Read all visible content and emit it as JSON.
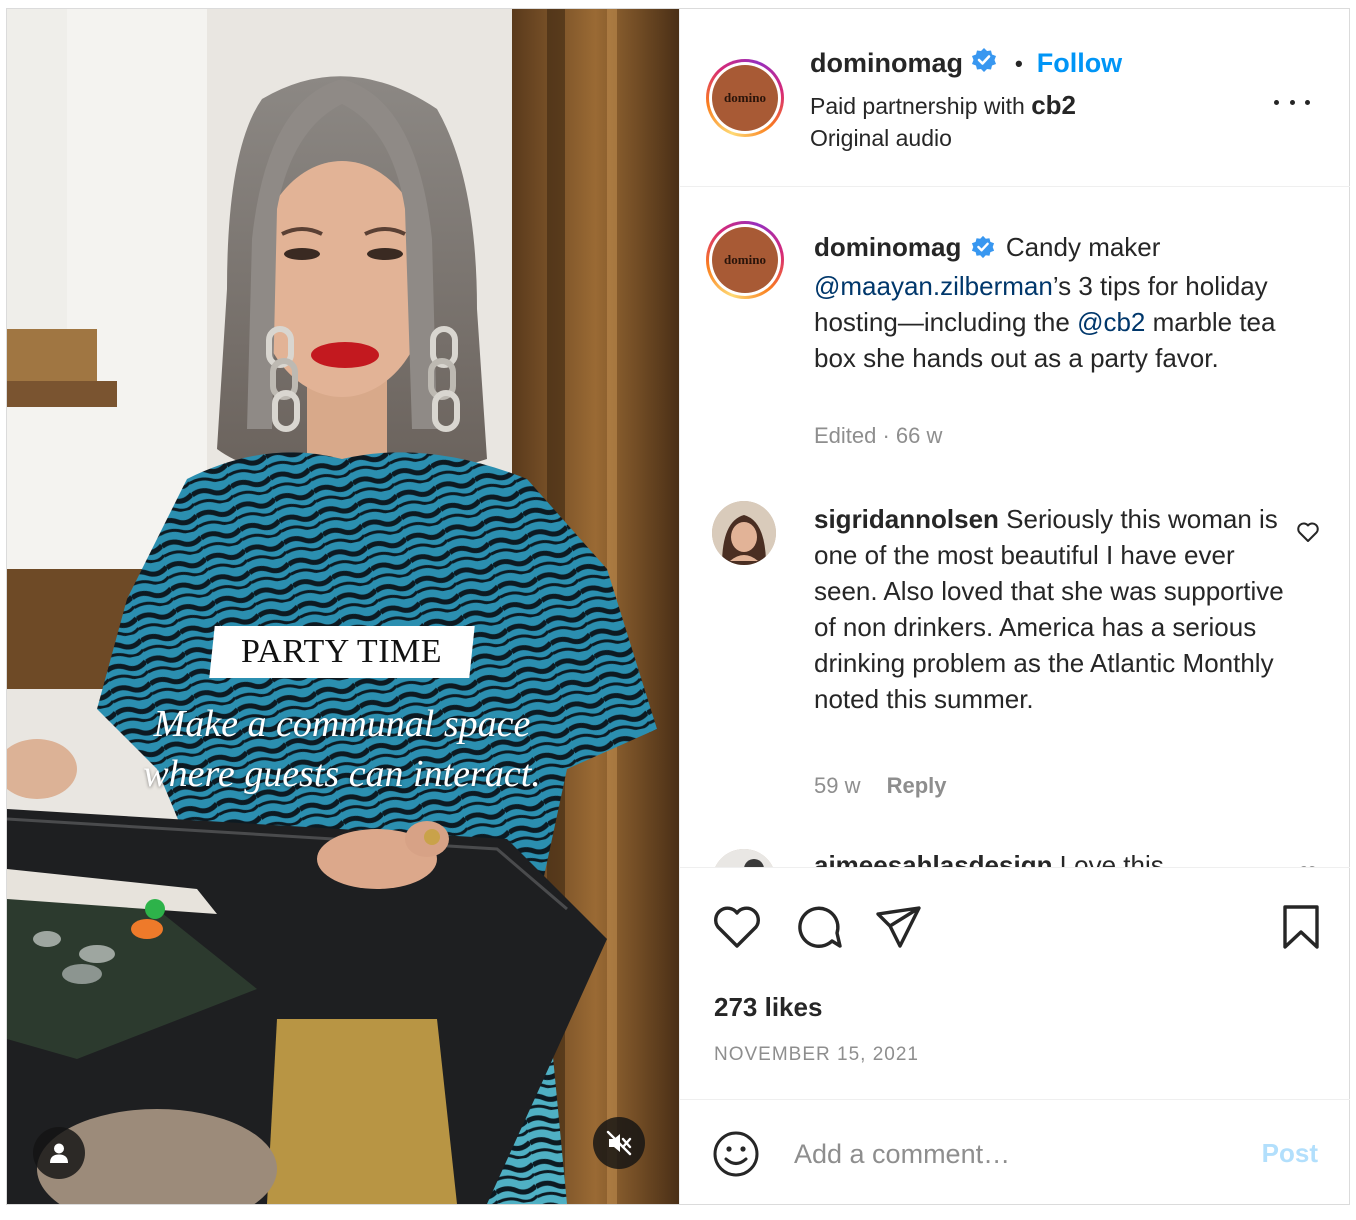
{
  "media": {
    "overlay_title": "PARTY TIME",
    "overlay_caption_line1": "Make a communal space",
    "overlay_caption_line2": "where guests can interact."
  },
  "header": {
    "avatar_text": "domino",
    "username": "dominomag",
    "separator": "•",
    "follow_label": "Follow",
    "partnership_prefix": "Paid partnership with",
    "partner": "cb2",
    "audio": "Original audio"
  },
  "caption": {
    "avatar_text": "domino",
    "username": "dominomag",
    "text_1": "Candy maker",
    "mention_1": "@maayan.zilberman",
    "text_2": "’s 3 tips for holiday hosting—including the",
    "mention_2": "@cb2",
    "text_3": "marble tea box she hands out as a party favor.",
    "meta": "Edited · 66 w"
  },
  "comments": [
    {
      "username": "sigridannolsen",
      "text": "Seriously this woman is one of the most beautiful I have ever seen. Also loved that she was supportive of non drinkers. America has a serious drinking problem as the Atlantic Monthly noted this summer.",
      "time": "59 w",
      "reply_label": "Reply"
    },
    {
      "username": "aimeesahlasdesign",
      "text": "Love this"
    }
  ],
  "actions": {
    "likes": "273 likes",
    "date": "NOVEMBER 15, 2021"
  },
  "composer": {
    "placeholder": "Add a comment…",
    "post_label": "Post"
  },
  "colors": {
    "accent": "#0095f6",
    "post_disabled": "#b2dffc",
    "mention": "#00376b",
    "muted": "#8e8e8e"
  }
}
